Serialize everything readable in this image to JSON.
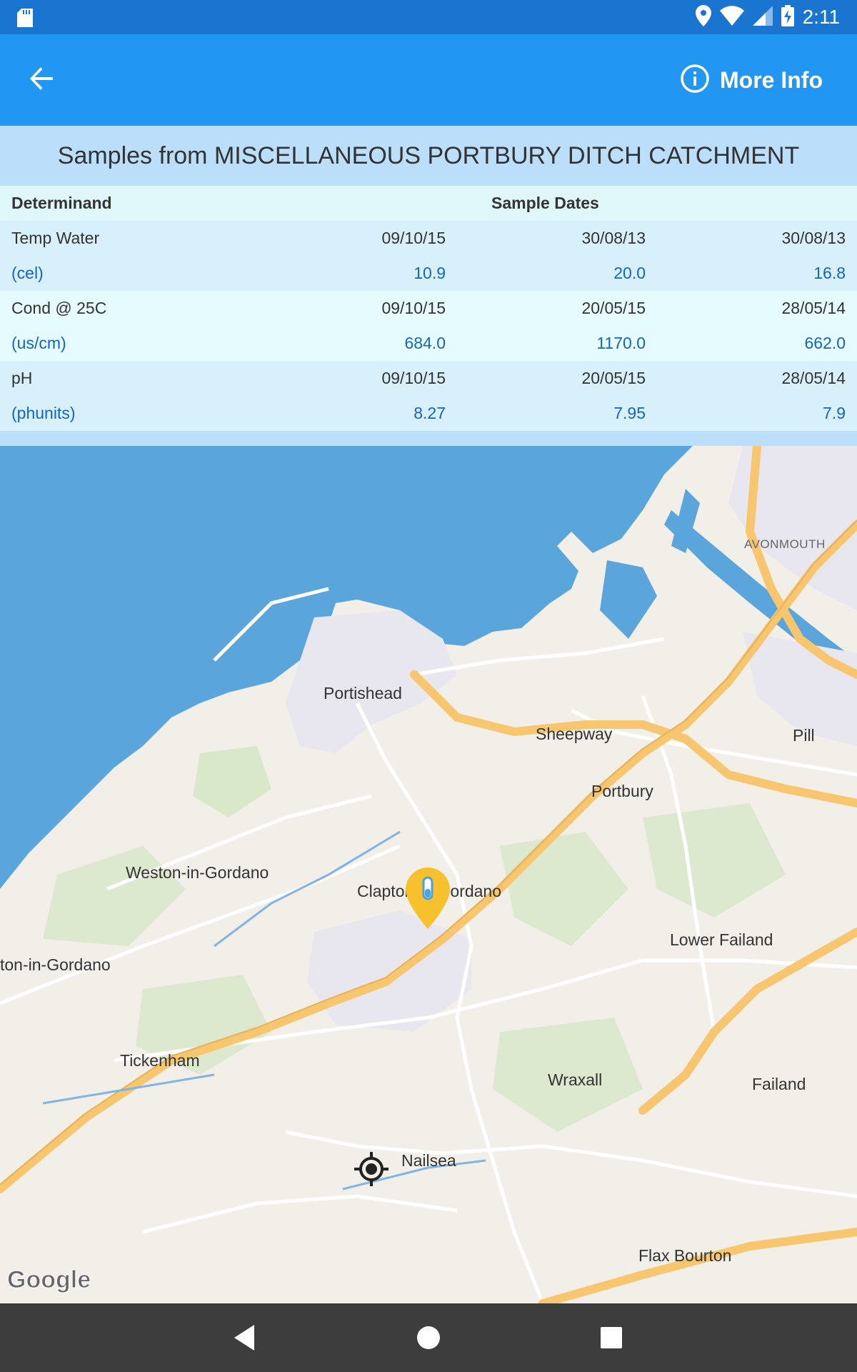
{
  "status_bar": {
    "time": "2:11",
    "icons": [
      "sd-card-icon",
      "location-icon",
      "wifi-icon",
      "cell-signal-icon",
      "battery-charging-icon"
    ]
  },
  "app_bar": {
    "back_icon": "arrow-back-icon",
    "more_info_label": "More Info",
    "more_info_icon": "info-icon",
    "color": "#2196f3"
  },
  "title": "Samples from MISCELLANEOUS PORTBURY DITCH CATCHMENT",
  "table": {
    "header": {
      "determinand": "Determinand",
      "sample_dates": "Sample Dates"
    },
    "rows": [
      {
        "name": "Temp Water",
        "unit": "(cel)",
        "dates": [
          "09/10/15",
          "30/08/13",
          "30/08/13"
        ],
        "values": [
          "10.9",
          "20.0",
          "16.8"
        ]
      },
      {
        "name": "Cond @ 25C",
        "unit": "(us/cm)",
        "dates": [
          "09/10/15",
          "20/05/15",
          "28/05/14"
        ],
        "values": [
          "684.0",
          "1170.0",
          "662.0"
        ]
      },
      {
        "name": "pH",
        "unit": "(phunits)",
        "dates": [
          "09/10/15",
          "20/05/15",
          "28/05/14"
        ],
        "values": [
          "8.27",
          "7.95",
          "7.9"
        ]
      }
    ]
  },
  "map": {
    "labels": {
      "avonmouth": "AVONMOUTH",
      "portishead": "Portishead",
      "sheepway": "Sheepway",
      "pill": "Pill",
      "portbury": "Portbury",
      "weston_in_gordano": "Weston-in-Gordano",
      "clapton_in_gordano": "Clapton-in-Gordano",
      "lower_failand": "Lower Failand",
      "easton_in_gordano": "ton-in-Gordano",
      "tickenham": "Tickenham",
      "wraxall": "Wraxall",
      "failand": "Failand",
      "nailsea": "Nailsea",
      "flax_bourton": "Flax Bourton"
    },
    "attribution": "Google",
    "markers": [
      "my-location-icon",
      "sample-pin-icon"
    ],
    "colors": {
      "sea": "#5ba5dd",
      "land": "#f2efe9",
      "motorway": "#f7c66f",
      "urban": "#e8e6ef"
    }
  },
  "nav_bar": {
    "icons": [
      "back-triangle-icon",
      "home-circle-icon",
      "recents-square-icon"
    ]
  }
}
